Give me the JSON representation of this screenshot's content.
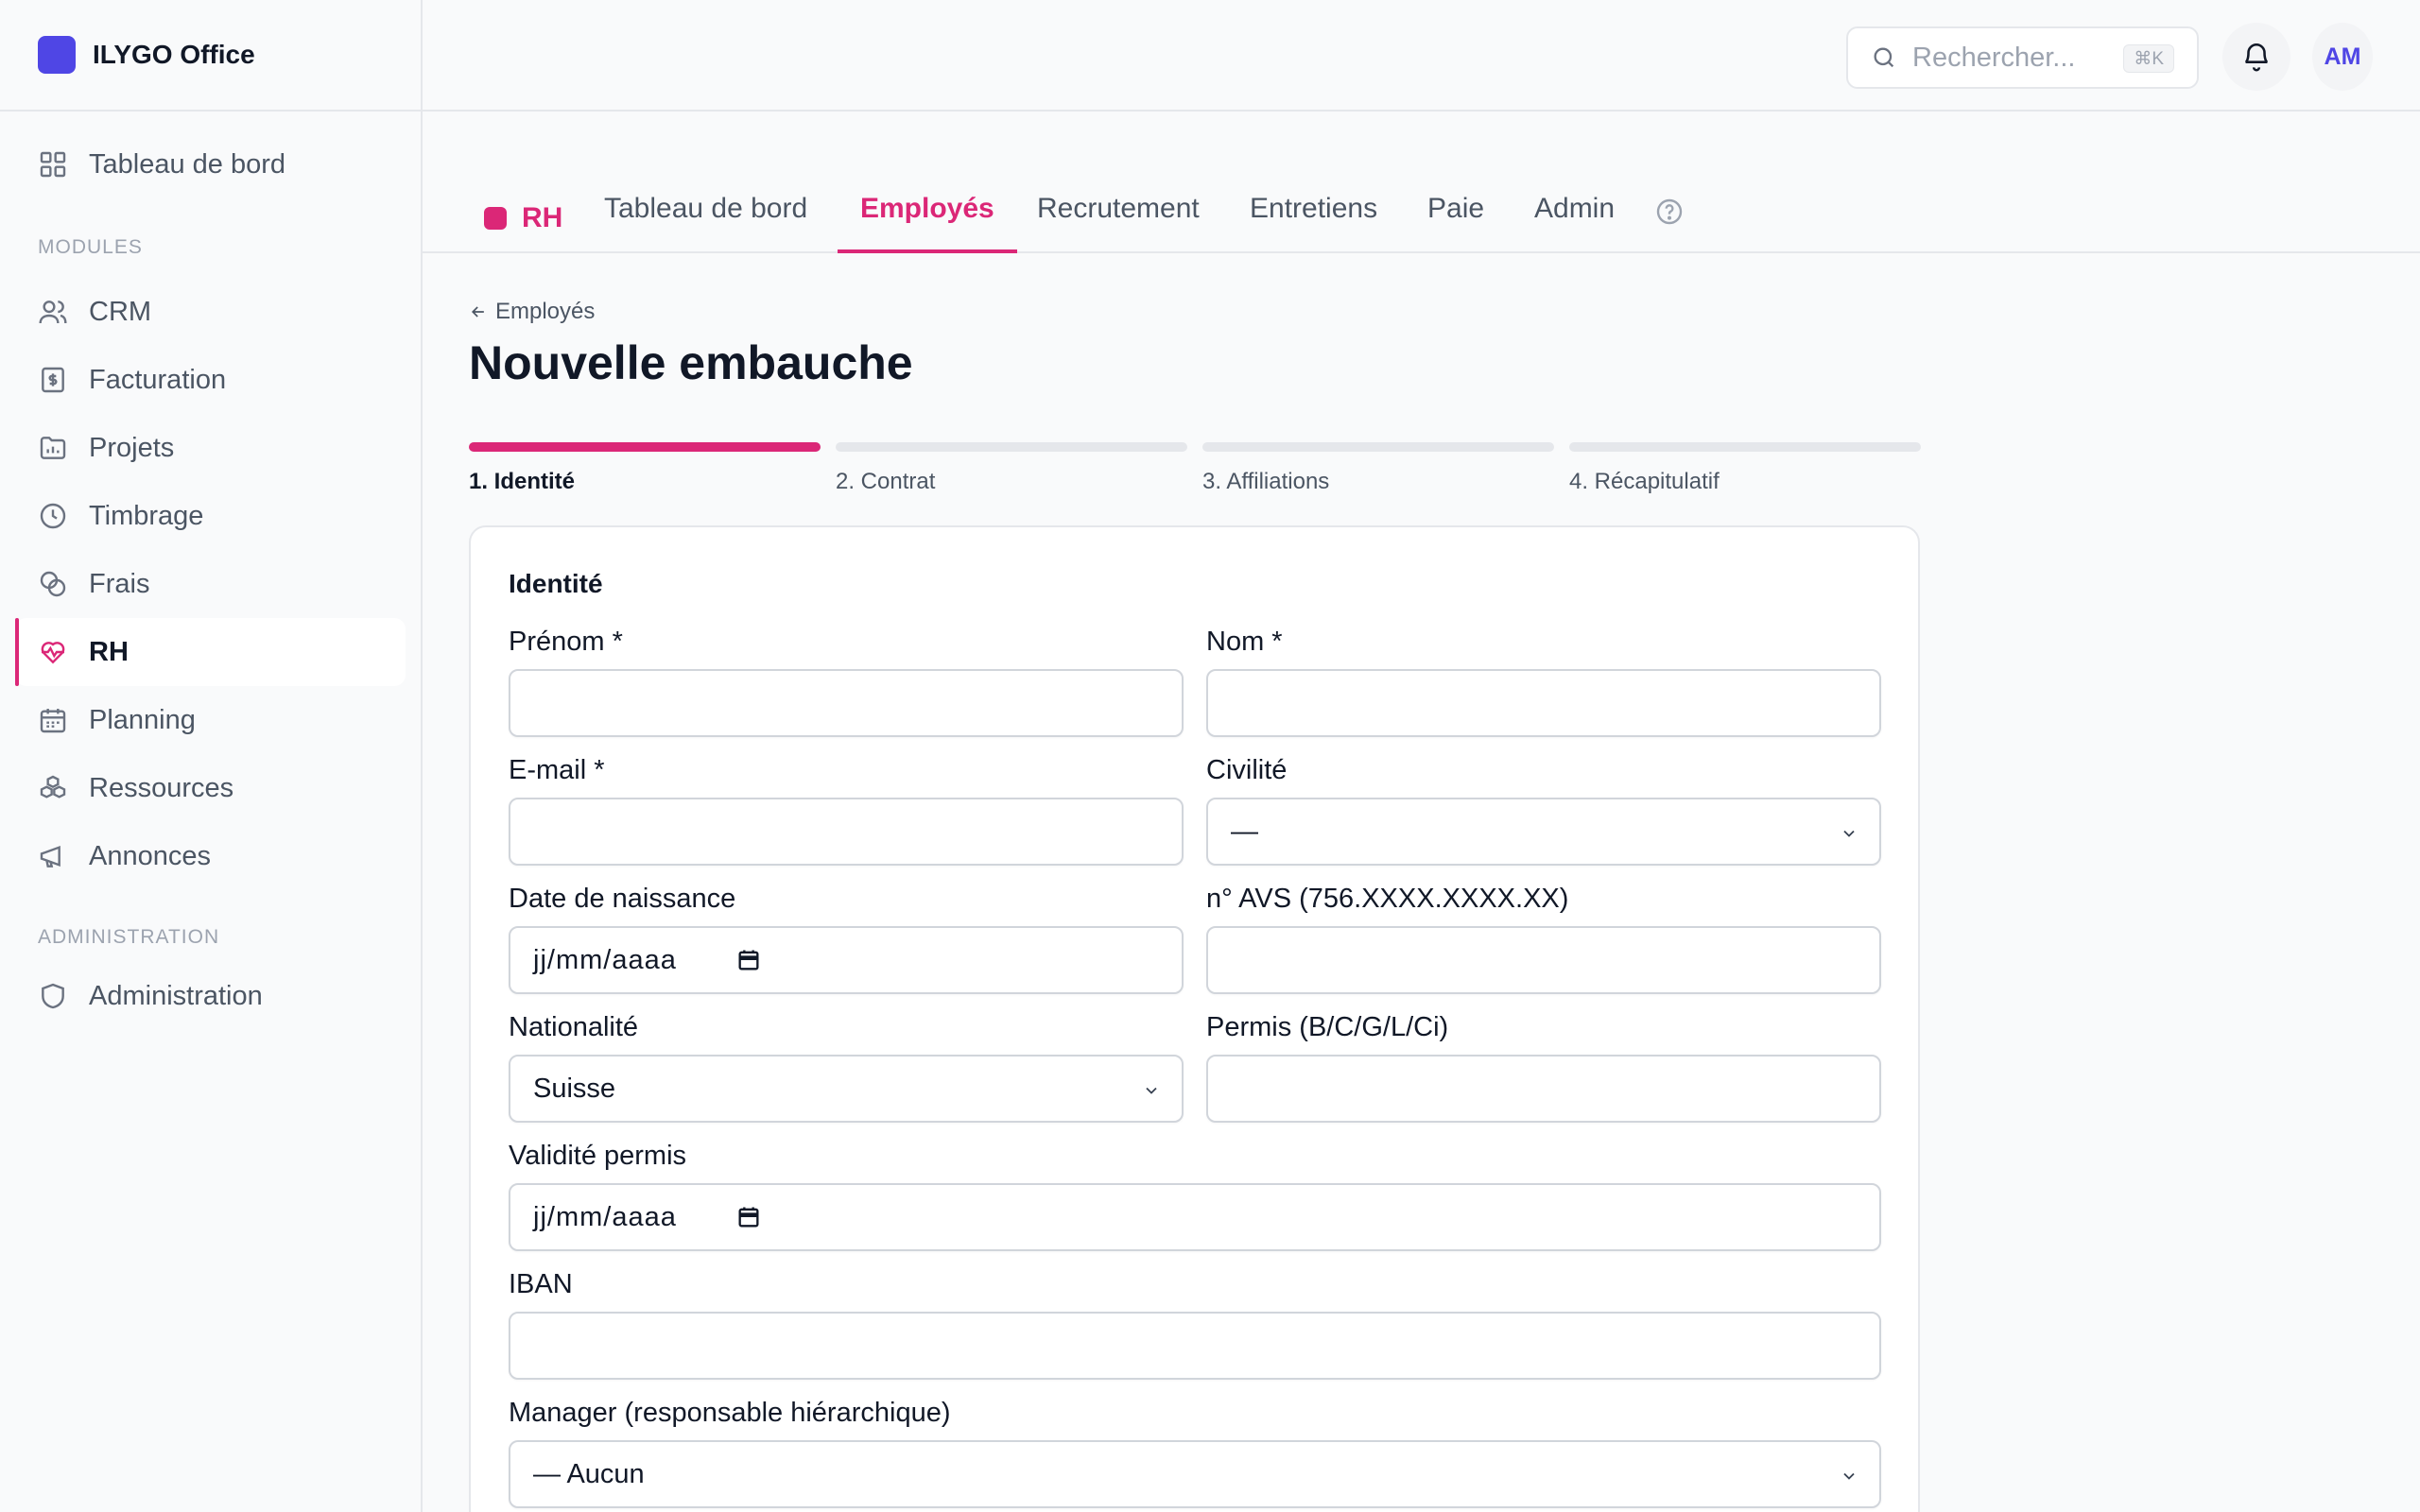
{
  "app": {
    "name": "ILYGO Office"
  },
  "sidebar": {
    "top_item": {
      "label": "Tableau de bord",
      "icon": "grid-icon"
    },
    "section_modules": "MODULES",
    "modules": [
      {
        "label": "CRM",
        "icon": "users-icon"
      },
      {
        "label": "Facturation",
        "icon": "invoice-icon"
      },
      {
        "label": "Projets",
        "icon": "folder-icon"
      },
      {
        "label": "Timbrage",
        "icon": "clock-icon"
      },
      {
        "label": "Frais",
        "icon": "coins-icon"
      },
      {
        "label": "RH",
        "icon": "heart-pulse-icon",
        "active": true
      },
      {
        "label": "Planning",
        "icon": "calendar-icon"
      },
      {
        "label": "Ressources",
        "icon": "boxes-icon"
      },
      {
        "label": "Annonces",
        "icon": "megaphone-icon"
      }
    ],
    "section_admin": "ADMINISTRATION",
    "admin": [
      {
        "label": "Administration",
        "icon": "shield-icon"
      }
    ]
  },
  "header": {
    "search_placeholder": "Rechercher...",
    "search_shortcut": "⌘K",
    "avatar_initials": "AM"
  },
  "tabs": {
    "module": "RH",
    "items": [
      "Tableau de bord",
      "Employés",
      "Recrutement",
      "Entretiens",
      "Paie",
      "Admin"
    ],
    "active": "Employés"
  },
  "page": {
    "back_label": "Employés",
    "title": "Nouvelle embauche",
    "steps": [
      "1. Identité",
      "2. Contrat",
      "3. Affiliations",
      "4. Récapitulatif"
    ],
    "active_step": 1
  },
  "form": {
    "section_title": "Identité",
    "fields": {
      "prenom": {
        "label": "Prénom *",
        "value": ""
      },
      "nom": {
        "label": "Nom *",
        "value": ""
      },
      "email": {
        "label": "E-mail *",
        "value": ""
      },
      "civilite": {
        "label": "Civilité",
        "value": "—"
      },
      "date_naissance": {
        "label": "Date de naissance",
        "value": "jj/mm/aaaa"
      },
      "avs": {
        "label": "n° AVS (756.XXXX.XXXX.XX)",
        "value": ""
      },
      "nationalite": {
        "label": "Nationalité",
        "value": "Suisse"
      },
      "permis": {
        "label": "Permis (B/C/G/L/Ci)",
        "value": ""
      },
      "validite_permis": {
        "label": "Validité permis",
        "value": "jj/mm/aaaa"
      },
      "iban": {
        "label": "IBAN",
        "value": ""
      },
      "manager": {
        "label": "Manager (responsable hiérarchique)",
        "value": "— Aucun"
      }
    }
  },
  "colors": {
    "accent": "#db2777",
    "brand": "#4f46e5"
  }
}
